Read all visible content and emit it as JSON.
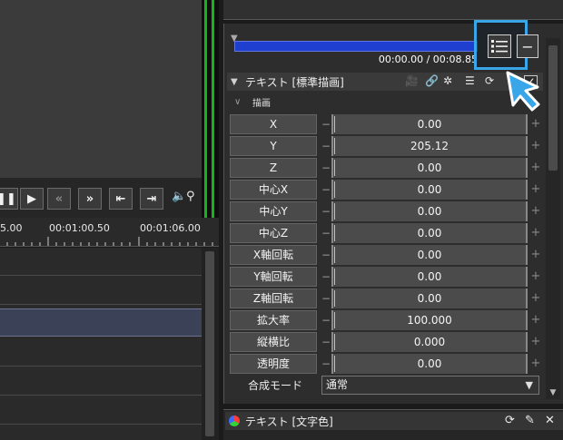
{
  "timeline": {
    "ruler_labels": [
      "5.00",
      "00:01:00.50",
      "00:01:06.00"
    ]
  },
  "properties": {
    "time_display": "00:00.00 / 00:08.85",
    "section_title": "テキスト [標準描画]",
    "subsection_label": "描画",
    "params": [
      {
        "label": "X",
        "value": "0.00"
      },
      {
        "label": "Y",
        "value": "205.12"
      },
      {
        "label": "Z",
        "value": "0.00"
      },
      {
        "label": "中心X",
        "value": "0.00"
      },
      {
        "label": "中心Y",
        "value": "0.00"
      },
      {
        "label": "中心Z",
        "value": "0.00"
      },
      {
        "label": "X軸回転",
        "value": "0.00"
      },
      {
        "label": "Y軸回転",
        "value": "0.00"
      },
      {
        "label": "Z軸回転",
        "value": "0.00"
      },
      {
        "label": "拡大率",
        "value": "100.000"
      },
      {
        "label": "縦横比",
        "value": "0.000"
      },
      {
        "label": "透明度",
        "value": "0.00"
      }
    ],
    "blend_mode_label": "合成モード",
    "blend_mode_value": "通常"
  },
  "footer": {
    "title": "テキスト [文字色]"
  },
  "colors": {
    "highlight": "#3aa6ea",
    "seekbar": "#1e3fcf",
    "meter": "#18b318",
    "selected_track": "#3b4157"
  }
}
